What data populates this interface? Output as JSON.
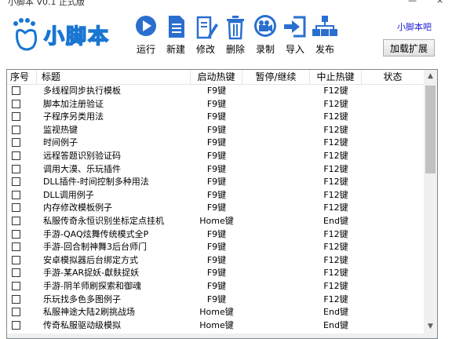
{
  "window": {
    "title": "小脚本 V0.1 正式版",
    "controls": {
      "minimize": "—",
      "close": "×"
    }
  },
  "logo": {
    "text": "小脚本"
  },
  "toolbar": {
    "items": [
      {
        "label": "运行",
        "icon": "play-icon"
      },
      {
        "label": "新建",
        "icon": "new-file-icon"
      },
      {
        "label": "修改",
        "icon": "edit-icon"
      },
      {
        "label": "删除",
        "icon": "trash-icon"
      },
      {
        "label": "录制",
        "icon": "record-camera-icon"
      },
      {
        "label": "导入",
        "icon": "import-icon"
      },
      {
        "label": "发布",
        "icon": "publish-icon"
      }
    ],
    "site_link": "小脚本吧",
    "extension_button": "加载扩展"
  },
  "table": {
    "columns": [
      "序号",
      "标题",
      "启动热键",
      "暂停/继续",
      "中止热键",
      "状态"
    ],
    "rows": [
      {
        "title": "多线程同步执行模板",
        "start": "F9键",
        "pause": "",
        "stop": "F12键",
        "status": ""
      },
      {
        "title": "脚本加注册验证",
        "start": "F9键",
        "pause": "",
        "stop": "F12键",
        "status": ""
      },
      {
        "title": "子程序另类用法",
        "start": "F9键",
        "pause": "",
        "stop": "F12键",
        "status": ""
      },
      {
        "title": "监视热键",
        "start": "F9键",
        "pause": "",
        "stop": "F12键",
        "status": ""
      },
      {
        "title": "时间例子",
        "start": "F9键",
        "pause": "",
        "stop": "F12键",
        "status": ""
      },
      {
        "title": "远程答题识别验证码",
        "start": "F9键",
        "pause": "",
        "stop": "F12键",
        "status": ""
      },
      {
        "title": "调用大漠、乐玩插件",
        "start": "F9键",
        "pause": "",
        "stop": "F12键",
        "status": ""
      },
      {
        "title": "DLL插件-时间控制多种用法",
        "start": "F9键",
        "pause": "",
        "stop": "F12键",
        "status": ""
      },
      {
        "title": "DLL调用例子",
        "start": "F9键",
        "pause": "",
        "stop": "F12键",
        "status": ""
      },
      {
        "title": "内存修改模板例子",
        "start": "F9键",
        "pause": "",
        "stop": "F12键",
        "status": ""
      },
      {
        "title": "私服传奇永恒识别坐标定点挂机",
        "start": "Home键",
        "pause": "",
        "stop": "End键",
        "status": ""
      },
      {
        "title": "手游-QAQ炫舞传统模式全P",
        "start": "F9键",
        "pause": "",
        "stop": "F12键",
        "status": ""
      },
      {
        "title": "手游-回合制神舞3后台师门",
        "start": "F9键",
        "pause": "",
        "stop": "F12键",
        "status": ""
      },
      {
        "title": "安卓模拟器后台绑定方式",
        "start": "F9键",
        "pause": "",
        "stop": "F12键",
        "status": ""
      },
      {
        "title": "手游-某AR捉妖-獻麸捉妖",
        "start": "F9键",
        "pause": "",
        "stop": "F12键",
        "status": ""
      },
      {
        "title": "手游-阴羊师刷探索和御魂",
        "start": "F9键",
        "pause": "",
        "stop": "F12键",
        "status": ""
      },
      {
        "title": "乐玩找多色多图例子",
        "start": "F9键",
        "pause": "",
        "stop": "F12键",
        "status": ""
      },
      {
        "title": "私服神途大陆2刷挑战场",
        "start": "Home键",
        "pause": "",
        "stop": "End键",
        "status": ""
      },
      {
        "title": "传奇私服驱动级模拟",
        "start": "Home键",
        "pause": "",
        "stop": "End键",
        "status": ""
      }
    ]
  },
  "colors": {
    "brand": "#1976d2",
    "toolbar_icon": "#2a6fcf",
    "link": "#1a1ad4"
  }
}
